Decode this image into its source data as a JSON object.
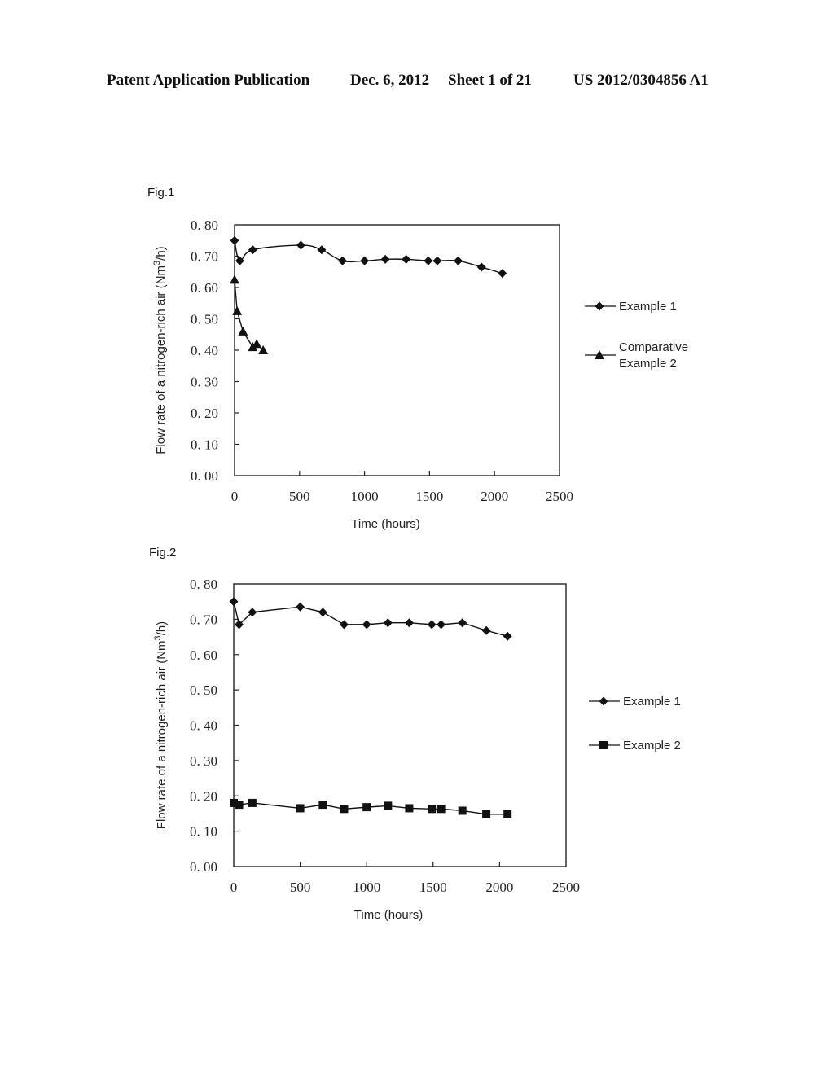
{
  "header": {
    "publication": "Patent Application Publication",
    "date": "Dec. 6, 2012",
    "sheet": "Sheet 1 of 21",
    "number": "US 2012/0304856 A1"
  },
  "chart_data": [
    {
      "type": "line",
      "figure_label": "Fig.1",
      "title": "",
      "xlabel": "Time (hours)",
      "ylabel": "Flow rate of a nitrogen-rich air (Nm3/h)",
      "ylabel_main": "Flow rate of a nitrogen-rich air (Nm",
      "ylabel_sup": "3",
      "ylabel_end": "/h)",
      "xlim": [
        0,
        2500
      ],
      "ylim": [
        0,
        0.8
      ],
      "x_ticks": [
        "0",
        "500",
        "1000",
        "1500",
        "2000",
        "2500"
      ],
      "y_ticks": [
        "0. 00",
        "0. 10",
        "0. 20",
        "0. 30",
        "0. 40",
        "0. 50",
        "0. 60",
        "0. 70",
        "0. 80"
      ],
      "grid": false,
      "legend_position": "right",
      "series": [
        {
          "name": "Example 1",
          "legend_lines": [
            "Example 1"
          ],
          "marker": "diamond",
          "smooth": true,
          "x": [
            0,
            40,
            140,
            510,
            670,
            830,
            1000,
            1160,
            1320,
            1490,
            1560,
            1720,
            1900,
            2060
          ],
          "values": [
            0.75,
            0.685,
            0.72,
            0.735,
            0.72,
            0.685,
            0.685,
            0.69,
            0.69,
            0.685,
            0.685,
            0.685,
            0.665,
            0.645
          ]
        },
        {
          "name": "Comparative Example 2",
          "legend_lines": [
            "Comparative",
            "Example 2"
          ],
          "marker": "triangle",
          "smooth": false,
          "x": [
            0,
            20,
            65,
            140,
            170,
            220
          ],
          "values": [
            0.625,
            0.525,
            0.46,
            0.41,
            0.42,
            0.4
          ]
        }
      ]
    },
    {
      "type": "line",
      "figure_label": "Fig.2",
      "title": "",
      "xlabel": "Time (hours)",
      "ylabel": "Flow rate of a nitrogen-rich air (Nm3/h)",
      "ylabel_main": "Flow rate of a nitrogen-rich air (Nm",
      "ylabel_sup": "3",
      "ylabel_end": "/h)",
      "xlim": [
        0,
        2500
      ],
      "ylim": [
        0,
        0.8
      ],
      "x_ticks": [
        "0",
        "500",
        "1000",
        "1500",
        "2000",
        "2500"
      ],
      "y_ticks": [
        "0. 00",
        "0. 10",
        "0. 20",
        "0. 30",
        "0. 40",
        "0. 50",
        "0. 60",
        "0. 70",
        "0. 80"
      ],
      "grid": false,
      "legend_position": "right",
      "series": [
        {
          "name": "Example 1",
          "legend_lines": [
            "Example 1"
          ],
          "marker": "diamond",
          "smooth": false,
          "x": [
            0,
            40,
            140,
            500,
            670,
            830,
            1000,
            1160,
            1320,
            1490,
            1560,
            1720,
            1900,
            2060
          ],
          "values": [
            0.75,
            0.685,
            0.72,
            0.735,
            0.72,
            0.685,
            0.685,
            0.69,
            0.69,
            0.685,
            0.685,
            0.69,
            0.668,
            0.652
          ]
        },
        {
          "name": "Example 2",
          "legend_lines": [
            "Example 2"
          ],
          "marker": "square",
          "smooth": false,
          "x": [
            0,
            40,
            140,
            500,
            670,
            830,
            1000,
            1160,
            1320,
            1490,
            1560,
            1720,
            1900,
            2060
          ],
          "values": [
            0.18,
            0.175,
            0.18,
            0.165,
            0.175,
            0.163,
            0.168,
            0.172,
            0.165,
            0.163,
            0.163,
            0.158,
            0.148,
            0.148
          ]
        }
      ]
    }
  ]
}
